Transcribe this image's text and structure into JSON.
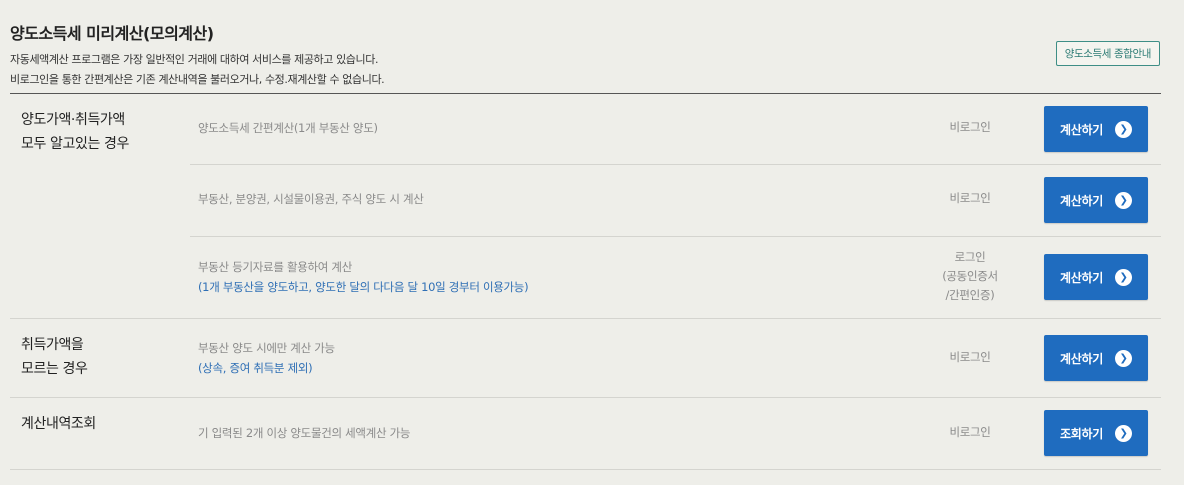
{
  "header": {
    "title": "양도소득세 미리계산(모의계산)",
    "desc_line1": "자동세액계산 프로그램은 가장 일반적인 거래에 대하여 서비스를 제공하고 있습니다.",
    "desc_line2": "비로그인을 통한 간편계산은 기존 계산내역을 불러오거나, 수정.재계산할 수 없습니다.",
    "guide_button": "양도소득세 종합안내"
  },
  "groups": [
    {
      "label": "양도가액·취득가액\n모두 알고있는 경우",
      "rows": [
        {
          "text": "양도소득세 간편계산(1개 부동산 양도)",
          "note": "",
          "login": "비로그인",
          "button": "계산하기"
        },
        {
          "text": "부동산, 분양권, 시설물이용권, 주식 양도 시 계산",
          "note": "",
          "login": "비로그인",
          "button": "계산하기"
        },
        {
          "text": "부동산 등기자료를 활용하여 계산",
          "note": "(1개 부동산을 양도하고, 양도한 달의 다다음 달 10일 경부터 이용가능)",
          "login": "로그인\n(공동인증서\n/간편인증)",
          "button": "계산하기"
        }
      ]
    },
    {
      "label": "취득가액을\n모르는 경우",
      "rows": [
        {
          "text": "부동산 양도 시에만 계산 가능",
          "note": "(상속, 증여 취득분 제외)",
          "login": "비로그인",
          "button": "계산하기"
        }
      ]
    },
    {
      "label": "계산내역조회",
      "rows": [
        {
          "text": "기 입력된 2개 이상 양도물건의 세액계산 가능",
          "note": "",
          "login": "비로그인",
          "button": "조회하기"
        }
      ]
    }
  ],
  "icons": {
    "button_arrow": "chevron-right-circle-icon"
  },
  "colors": {
    "accent": "#1f6cbf",
    "note_text": "#2f6fb5",
    "guide_border": "#3e8e86",
    "background": "#eeeee9"
  }
}
